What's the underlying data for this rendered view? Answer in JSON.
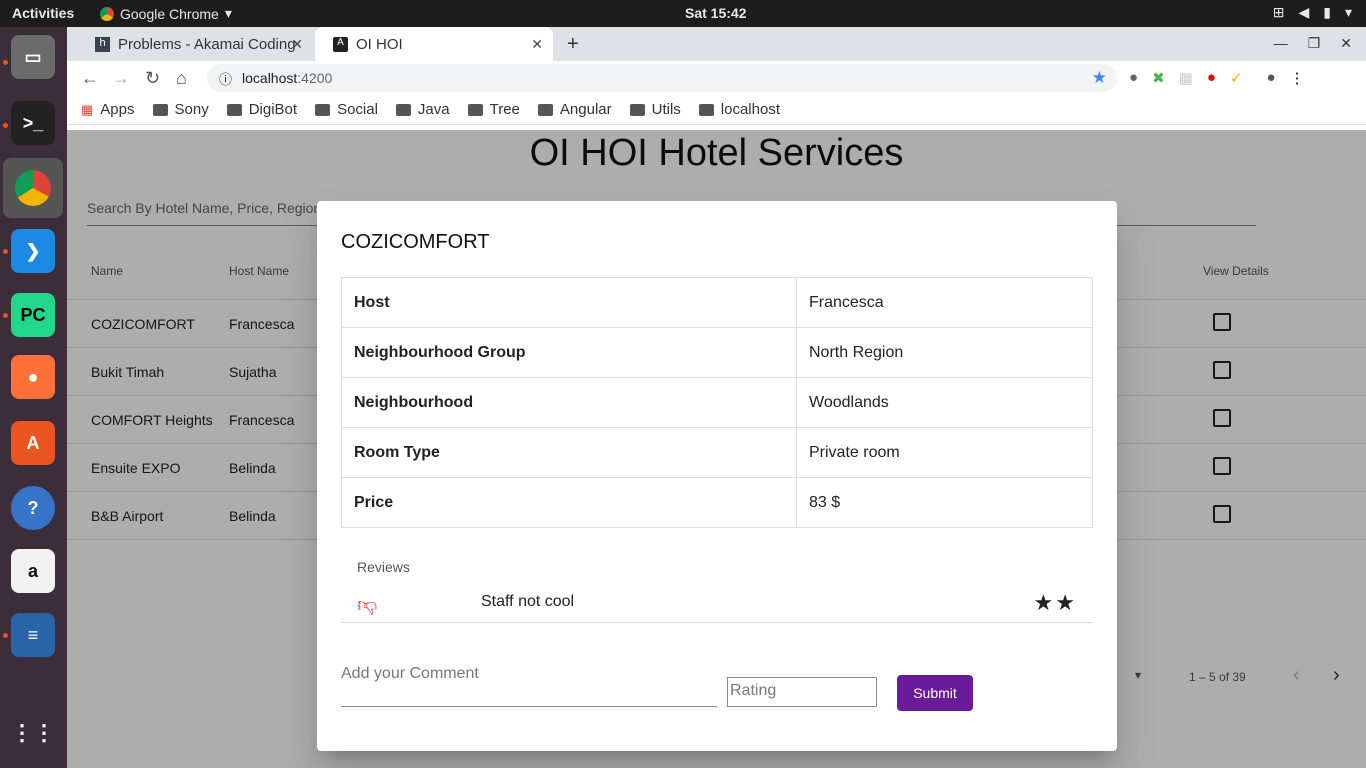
{
  "os": {
    "activities": "Activities",
    "app_name": "Google Chrome",
    "clock": "Sat 15:42"
  },
  "browser": {
    "tabs": [
      {
        "label": "Problems - Akamai Coding"
      },
      {
        "label": "OI HOI"
      }
    ],
    "url_host": "localhost",
    "url_port": ":4200",
    "bookmarks": [
      "Apps",
      "Sony",
      "DigiBot",
      "Social",
      "Java",
      "Tree",
      "Angular",
      "Utils",
      "localhost"
    ]
  },
  "page": {
    "title": "OI HOI Hotel Services",
    "search_placeholder": "Search By Hotel Name, Price, Region",
    "columns": {
      "name": "Name",
      "host": "Host Name",
      "view": "View Details"
    },
    "rows": [
      {
        "name": "COZICOMFORT",
        "host": "Francesca"
      },
      {
        "name": "Bukit Timah",
        "host": "Sujatha"
      },
      {
        "name": "COMFORT Heights",
        "host": "Francesca"
      },
      {
        "name": "Ensuite EXPO",
        "host": "Belinda"
      },
      {
        "name": "B&B Airport",
        "host": "Belinda"
      }
    ],
    "range": "1 – 5 of 39"
  },
  "dialog": {
    "title": "COZICOMFORT",
    "details": [
      {
        "label": "Host",
        "value": "Francesca"
      },
      {
        "label": "Neighbourhood Group",
        "value": "North Region"
      },
      {
        "label": "Neighbourhood",
        "value": "Woodlands"
      },
      {
        "label": "Room Type",
        "value": "Private room"
      },
      {
        "label": "Price",
        "value": "83 $"
      }
    ],
    "reviews_label": "Reviews",
    "review": {
      "text": "Staff not cool",
      "rating": 2,
      "stars": "★★"
    },
    "comment_placeholder": "Add your Comment",
    "rating_placeholder": "Rating",
    "submit_label": "Submit"
  }
}
